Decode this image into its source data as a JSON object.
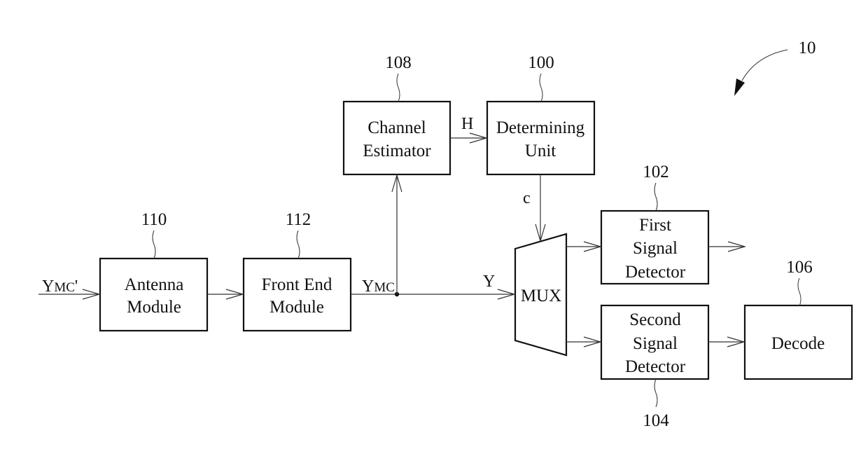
{
  "figure": {
    "reference": "10",
    "blocks": [
      {
        "id": "antenna",
        "ref": "110",
        "lines": [
          "Antenna",
          "Module"
        ]
      },
      {
        "id": "frontend",
        "ref": "112",
        "lines": [
          "Front End",
          "Module"
        ]
      },
      {
        "id": "channel",
        "ref": "108",
        "lines": [
          "Channel",
          "Estimator"
        ]
      },
      {
        "id": "determining",
        "ref": "100",
        "lines": [
          "Determining",
          "Unit"
        ]
      },
      {
        "id": "mux",
        "ref": "",
        "lines": [
          "MUX"
        ]
      },
      {
        "id": "first",
        "ref": "102",
        "lines": [
          "First",
          "Signal",
          "Detector"
        ]
      },
      {
        "id": "second",
        "ref": "104",
        "lines": [
          "Second",
          "Signal",
          "Detector"
        ]
      },
      {
        "id": "decode",
        "ref": "106",
        "lines": [
          "Decode"
        ]
      }
    ],
    "signals": {
      "input": {
        "main": "Y",
        "sub": "MC",
        "suffix": "'"
      },
      "frontend_out": {
        "main": "Y",
        "sub": "MC"
      },
      "mux_in": "Y",
      "channel_out": "H",
      "control": "c"
    }
  }
}
